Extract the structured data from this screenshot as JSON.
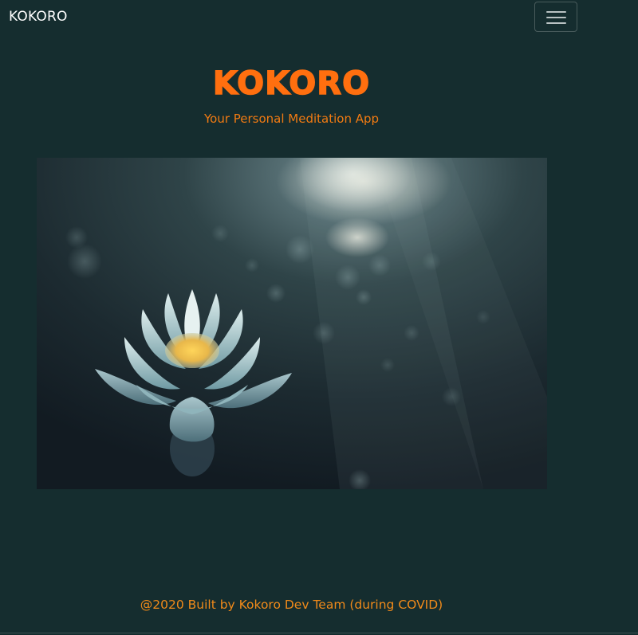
{
  "navbar": {
    "brand": "KOKORO",
    "menu_icon": "hamburger-menu-icon"
  },
  "hero": {
    "title": "KOKORO",
    "subtitle": "Your Personal Meditation App",
    "image_icon": "lotus-flower-photo"
  },
  "footer": {
    "text": "@2020 Built by Kokoro Dev Team (during COVID)"
  },
  "colors": {
    "background": "#152d2f",
    "accent": "#ff6f0f",
    "brand_text": "#ffffff"
  }
}
